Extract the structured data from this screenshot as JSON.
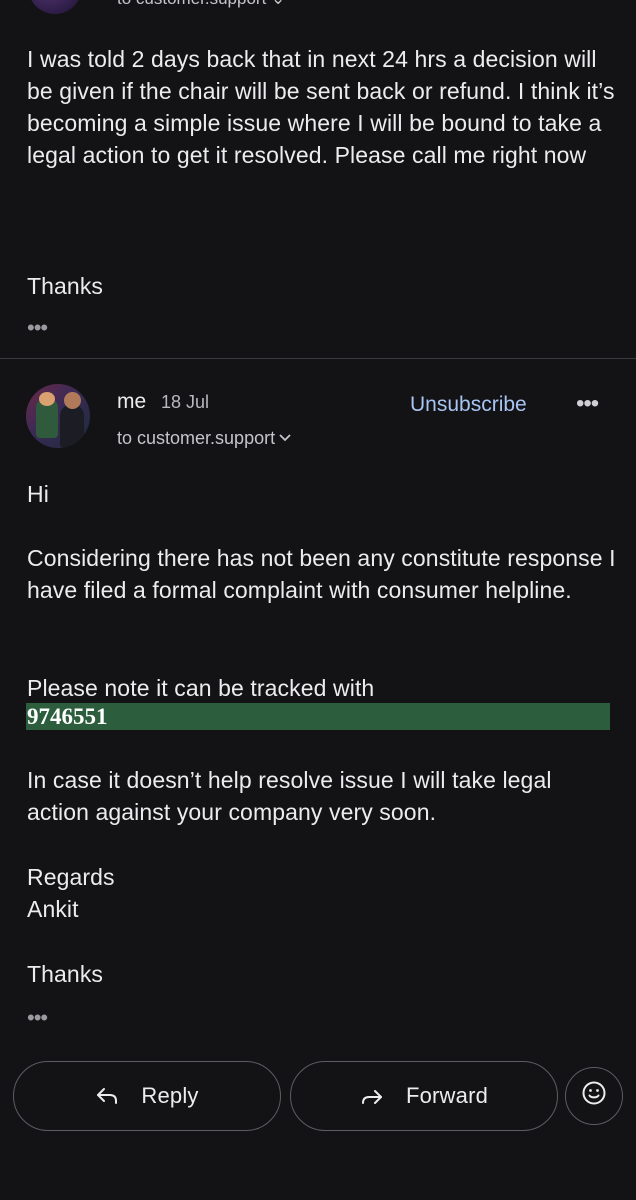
{
  "previous_message": {
    "to_line": "to customer.support ⌄",
    "body": "I was told 2 days back that in next 24 hrs a decision will be given if the chair will be sent back or refund. I think it’s becoming a simple issue where I will be bound to take a legal action to get it resolved. Please call me right now",
    "closing": "Thanks",
    "more_label": "•••"
  },
  "message": {
    "sender": "me",
    "date": "18 Jul",
    "unsubscribe_label": "Unsubscribe",
    "more_label": "•••",
    "to_line": "to customer.support",
    "greeting": "Hi",
    "paragraph1": "Considering there has not been any constitute response I have filed a formal complaint with consumer helpline.",
    "tracking_intro": "Please note it can be tracked with",
    "tracking_number": "9746551",
    "paragraph2": "In case it doesn’t help resolve issue I will take legal action against your company very soon.",
    "regards": "Regards",
    "signature": "Ankit",
    "closing": "Thanks",
    "trim_label": "•••"
  },
  "actions": {
    "reply_label": "Reply",
    "forward_label": "Forward"
  },
  "colors": {
    "background": "#131316",
    "link": "#a8c4f2",
    "highlight": "#2c5e3d"
  }
}
